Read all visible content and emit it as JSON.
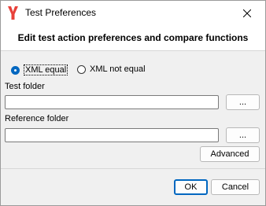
{
  "window": {
    "title": "Test Preferences",
    "close_icon": "close-icon",
    "app_icon": "app-logo-icon"
  },
  "header": {
    "heading": "Edit test action preferences and compare functions"
  },
  "comparison": {
    "options": [
      {
        "label": "XML equal",
        "selected": true
      },
      {
        "label": "XML not equal",
        "selected": false
      }
    ]
  },
  "test_folder": {
    "label": "Test folder",
    "value": "",
    "browse_label": "..."
  },
  "reference_folder": {
    "label": "Reference folder",
    "value": "",
    "browse_label": "..."
  },
  "buttons": {
    "advanced": "Advanced",
    "ok": "OK",
    "cancel": "Cancel"
  },
  "colors": {
    "accent": "#0067c0",
    "logo": "#e8413a"
  }
}
